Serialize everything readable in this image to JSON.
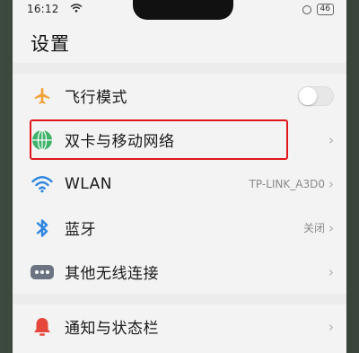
{
  "status_bar": {
    "time": "16:12",
    "battery": "46"
  },
  "page": {
    "title": "设置"
  },
  "items": [
    {
      "label": "飞行模式",
      "icon": "airplane-icon"
    },
    {
      "label": "双卡与移动网络",
      "icon": "globe-icon"
    },
    {
      "label": "WLAN",
      "icon": "wifi-icon",
      "value": "TP-LINK_A3D0"
    },
    {
      "label": "蓝牙",
      "icon": "bluetooth-icon",
      "value": "关闭"
    },
    {
      "label": "其他无线连接",
      "icon": "more-dots-icon"
    },
    {
      "label": "通知与状态栏",
      "icon": "bell-icon"
    }
  ],
  "colors": {
    "highlight": "#e0161b",
    "airplane": "#f2a23b",
    "globe": "#3fb36a",
    "wifi": "#2f86e0",
    "bluetooth": "#2f86e0",
    "dots": "#6b7480",
    "bell": "#e5473b"
  },
  "toggles": {
    "airplane_mode_on": false
  }
}
